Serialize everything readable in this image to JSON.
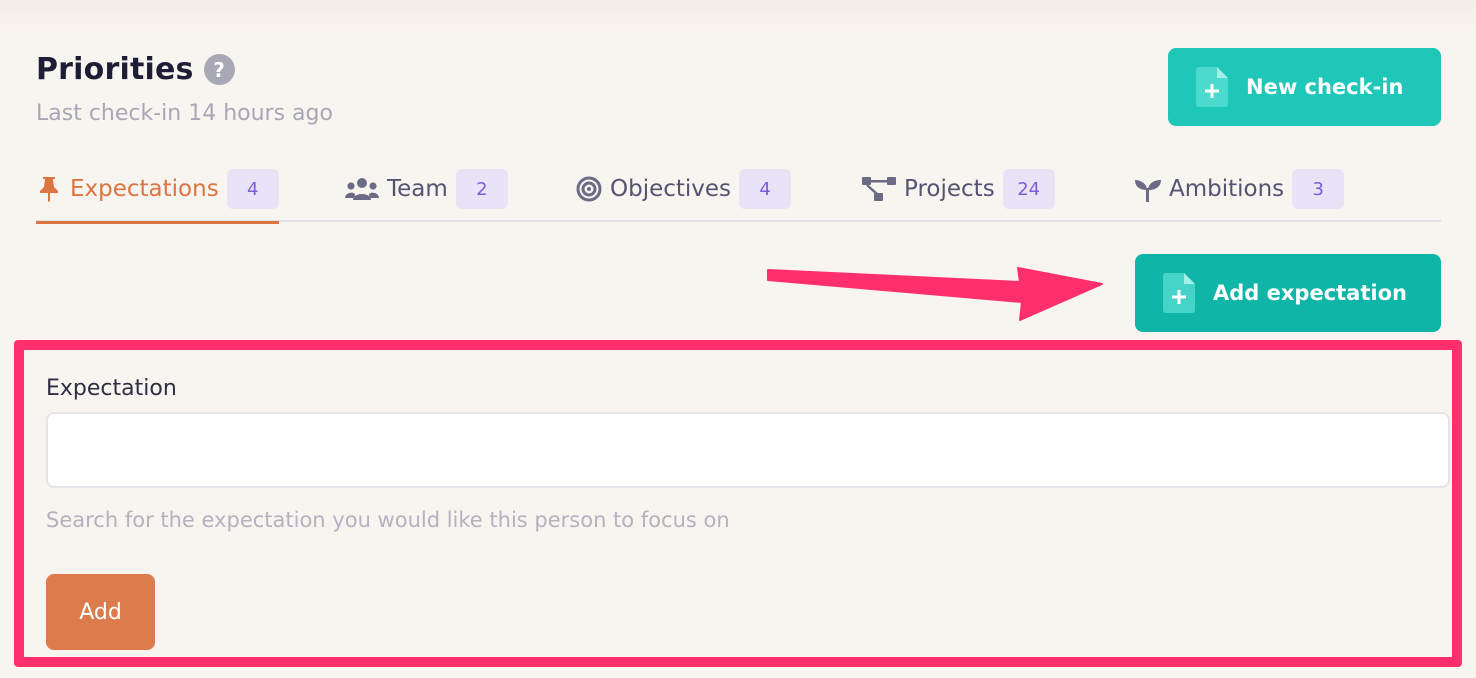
{
  "header": {
    "title": "Priorities",
    "help_icon": "question-circle-icon",
    "subtitle": "Last check-in 14 hours ago",
    "new_checkin_label": "New check-in"
  },
  "tabs": [
    {
      "label": "Expectations",
      "count": "4",
      "icon": "pushpin-icon",
      "active": true
    },
    {
      "label": "Team",
      "count": "2",
      "icon": "users-icon",
      "active": false
    },
    {
      "label": "Objectives",
      "count": "4",
      "icon": "target-icon",
      "active": false
    },
    {
      "label": "Projects",
      "count": "24",
      "icon": "project-diagram-icon",
      "active": false
    },
    {
      "label": "Ambitions",
      "count": "3",
      "icon": "seedling-icon",
      "active": false
    }
  ],
  "actions": {
    "add_expectation_label": "Add expectation"
  },
  "form": {
    "field_label": "Expectation",
    "input_value": "",
    "input_placeholder": "",
    "hint": "Search for the expectation you would like this person to focus on",
    "submit_label": "Add"
  },
  "colors": {
    "background": "#f8f4ef",
    "teal": "#1fc7b8",
    "active_tab": "#dc7542",
    "badge_bg": "#e9e3f7",
    "badge_text": "#7b5cd9",
    "highlight": "#ff2f6c",
    "add_button": "#dc7b4b"
  }
}
